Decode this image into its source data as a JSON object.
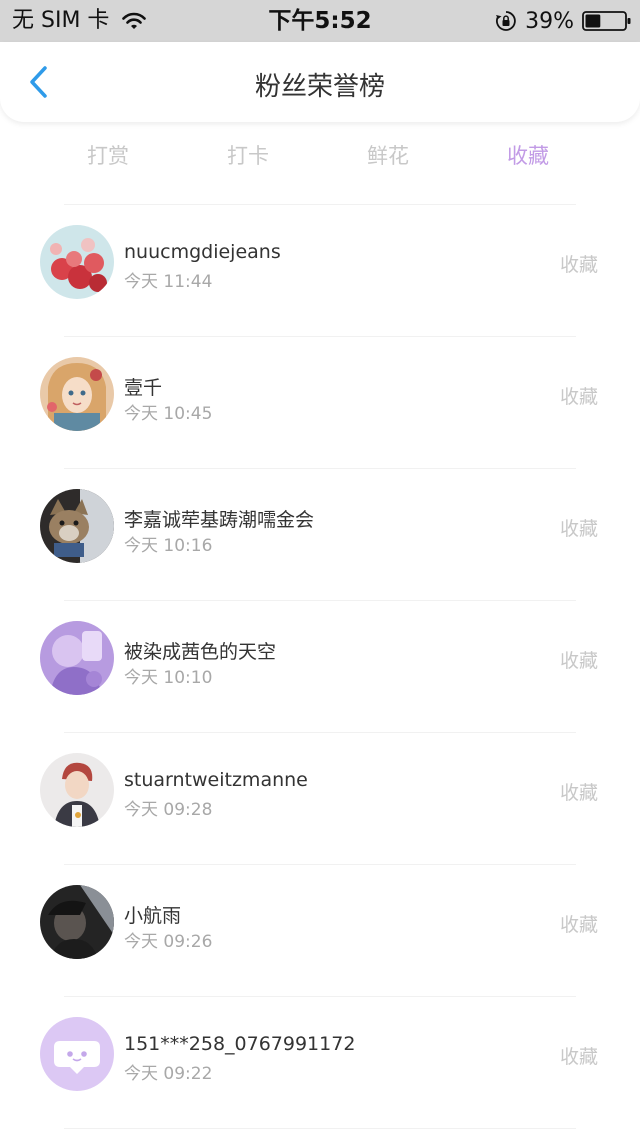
{
  "status_bar": {
    "carrier": "无 SIM 卡",
    "time": "下午5:52",
    "battery": "39%",
    "battery_level": 0.39
  },
  "header": {
    "title": "粉丝荣誉榜"
  },
  "tabs": [
    {
      "label": "打赏",
      "active": false
    },
    {
      "label": "打卡",
      "active": false
    },
    {
      "label": "鲜花",
      "active": false
    },
    {
      "label": "收藏",
      "active": true
    }
  ],
  "colors": {
    "accent": "#c29be6",
    "back": "#2f9be9",
    "muted": "#c8c8c8",
    "status_bar": "#d6d6d6"
  },
  "list": [
    {
      "name": "nuucmgdiejeans",
      "time": "今天 11:44",
      "action": "收藏",
      "avatar": "red-balloons-avatar"
    },
    {
      "name": "壹千",
      "time": "今天 10:45",
      "action": "收藏",
      "avatar": "anime-girl-avatar"
    },
    {
      "name": "李嘉诚荦基踌潮嚅金会",
      "time": "今天 10:16",
      "action": "收藏",
      "avatar": "cat-avatar"
    },
    {
      "name": "被染成茜色的天空",
      "time": "今天 10:10",
      "action": "收藏",
      "avatar": "purple-portrait-avatar"
    },
    {
      "name": "stuarntweitzmanne",
      "time": "今天 09:28",
      "action": "收藏",
      "avatar": "boy-portrait-avatar"
    },
    {
      "name": "小航雨",
      "time": "今天 09:26",
      "action": "收藏",
      "avatar": "dark-portrait-avatar"
    },
    {
      "name": "151***258_0767991172",
      "time": "今天 09:22",
      "action": "收藏",
      "avatar": "default-chat-avatar"
    }
  ]
}
